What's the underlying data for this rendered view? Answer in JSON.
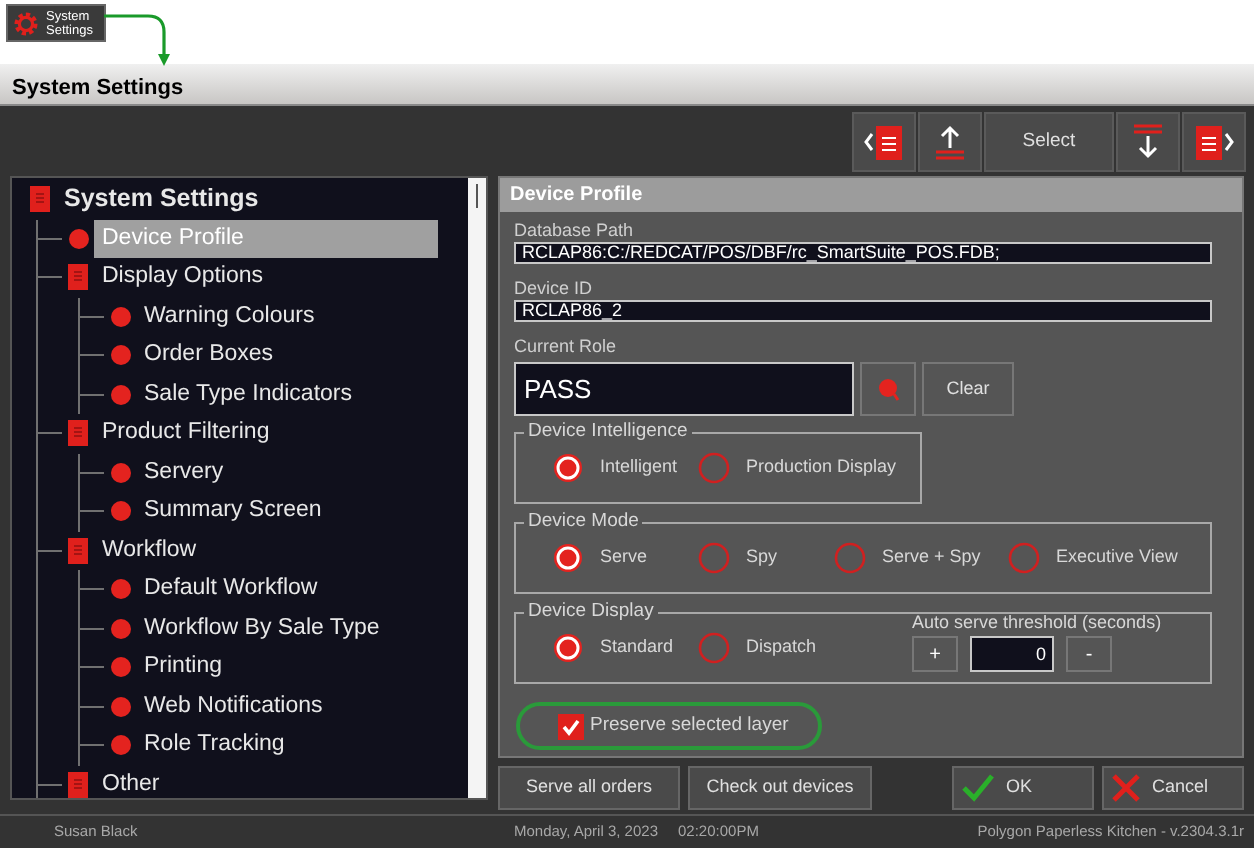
{
  "shortcut": {
    "label": "System Settings"
  },
  "window": {
    "title": "System Settings"
  },
  "toolbar": {
    "buttons": [
      {
        "kind": "prev-page"
      },
      {
        "kind": "up"
      },
      {
        "kind": "text",
        "label": "Select"
      },
      {
        "kind": "down"
      },
      {
        "kind": "next-page"
      }
    ]
  },
  "tree": {
    "root": {
      "label": "System Settings",
      "kind": "folder",
      "selected": false,
      "children": [
        {
          "label": "Device Profile",
          "kind": "leaf",
          "selected": true
        },
        {
          "label": "Display Options",
          "kind": "folder",
          "selected": false,
          "children": [
            {
              "label": "Warning Colours",
              "kind": "leaf",
              "selected": false
            },
            {
              "label": "Order Boxes",
              "kind": "leaf",
              "selected": false
            },
            {
              "label": "Sale Type Indicators",
              "kind": "leaf",
              "selected": false
            }
          ]
        },
        {
          "label": "Product Filtering",
          "kind": "folder",
          "selected": false,
          "children": [
            {
              "label": "Servery",
              "kind": "leaf",
              "selected": false
            },
            {
              "label": "Summary Screen",
              "kind": "leaf",
              "selected": false
            }
          ]
        },
        {
          "label": "Workflow",
          "kind": "folder",
          "selected": false,
          "children": [
            {
              "label": "Default Workflow",
              "kind": "leaf",
              "selected": false
            },
            {
              "label": "Workflow By Sale Type",
              "kind": "leaf",
              "selected": false
            },
            {
              "label": "Printing",
              "kind": "leaf",
              "selected": false
            },
            {
              "label": "Web Notifications",
              "kind": "leaf",
              "selected": false
            },
            {
              "label": "Role Tracking",
              "kind": "leaf",
              "selected": false
            }
          ]
        },
        {
          "label": "Other",
          "kind": "folder",
          "selected": false
        }
      ]
    }
  },
  "panel": {
    "title": "Device Profile",
    "database_path": {
      "label": "Database Path",
      "value": "RCLAP86:C:/REDCAT/POS/DBF/rc_SmartSuite_POS.FDB;"
    },
    "device_id": {
      "label": "Device ID",
      "value": "RCLAP86_2"
    },
    "current_role": {
      "label": "Current Role",
      "value": "PASS",
      "clear": "Clear"
    },
    "device_intelligence": {
      "label": "Device Intelligence",
      "options": [
        {
          "label": "Intelligent",
          "selected": true
        },
        {
          "label": "Production Display",
          "selected": false
        }
      ]
    },
    "device_mode": {
      "label": "Device Mode",
      "options": [
        {
          "label": "Serve",
          "selected": true
        },
        {
          "label": "Spy",
          "selected": false
        },
        {
          "label": "Serve + Spy",
          "selected": false
        },
        {
          "label": "Executive View",
          "selected": false
        }
      ]
    },
    "device_display": {
      "label": "Device Display",
      "options": [
        {
          "label": "Standard",
          "selected": true
        },
        {
          "label": "Dispatch",
          "selected": false
        }
      ],
      "threshold": {
        "label": "Auto serve threshold (seconds)",
        "plus": "+",
        "value": "0",
        "minus": "-"
      }
    },
    "preserve_layer": {
      "label": "Preserve selected layer",
      "checked": true
    }
  },
  "actions": {
    "left": [
      "Serve all orders",
      "Check out devices"
    ],
    "ok": "OK",
    "cancel": "Cancel"
  },
  "status_bar": {
    "user": "Susan Black",
    "date": "Monday, April  3, 2023",
    "time": "02:20:00PM",
    "version": "Polygon Paperless Kitchen - v.2304.3.1r"
  }
}
